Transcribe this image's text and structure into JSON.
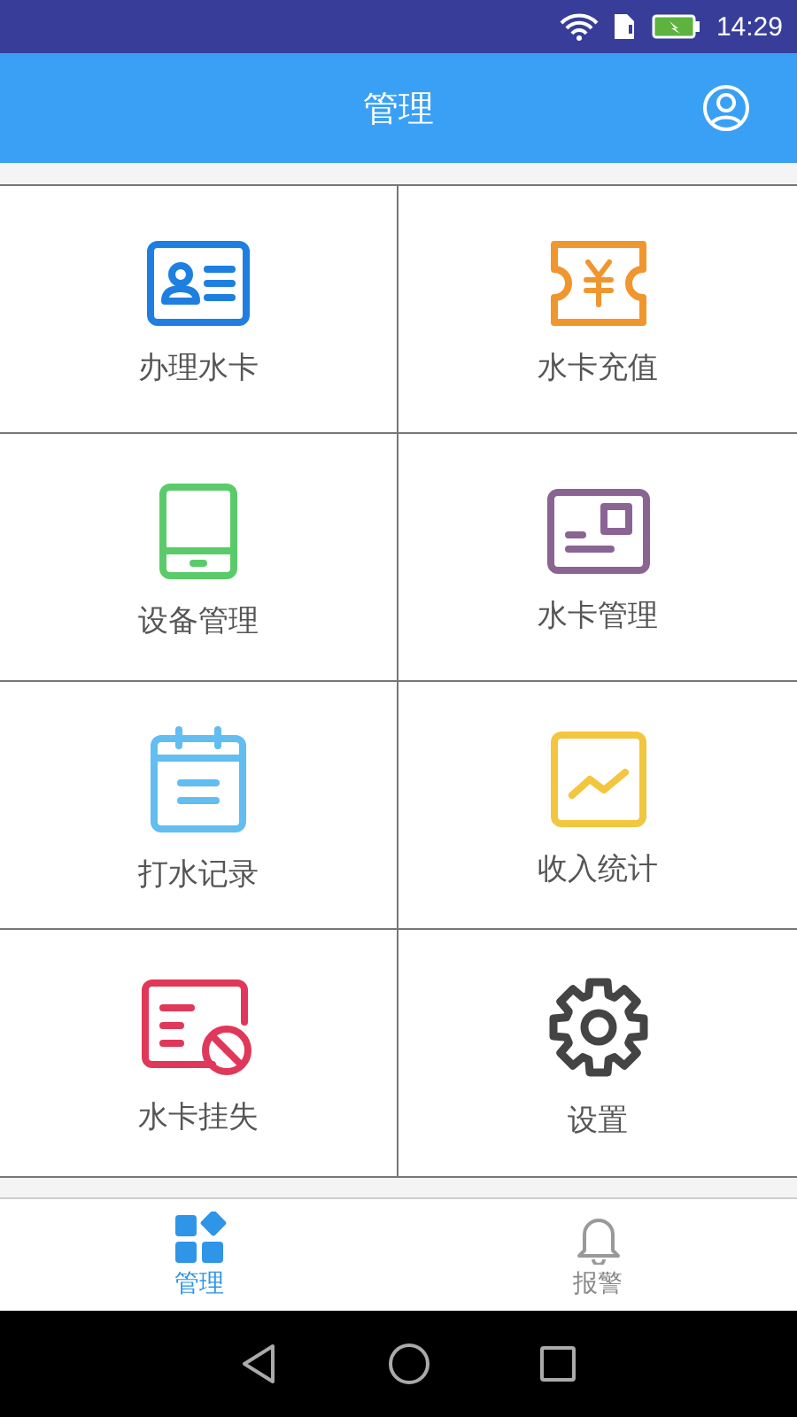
{
  "status_bar": {
    "time": "14:29",
    "battery_charging": true
  },
  "app_bar": {
    "title": "管理"
  },
  "tiles": [
    {
      "label": "办理水卡",
      "kind": "id-card",
      "color": "#1f7fe0"
    },
    {
      "label": "水卡充值",
      "kind": "ticket",
      "color": "#f0962e"
    },
    {
      "label": "设备管理",
      "kind": "tablet",
      "color": "#5acb6a"
    },
    {
      "label": "水卡管理",
      "kind": "card",
      "color": "#8a6593"
    },
    {
      "label": "打水记录",
      "kind": "calendar",
      "color": "#62bdf0"
    },
    {
      "label": "收入统计",
      "kind": "chart",
      "color": "#f2c63e"
    },
    {
      "label": "水卡挂失",
      "kind": "blocked",
      "color": "#e0385a"
    },
    {
      "label": "设置",
      "kind": "gear",
      "color": "#444444"
    }
  ],
  "bottom_tabs": [
    {
      "label": "管理",
      "kind": "grid",
      "selected": true
    },
    {
      "label": "报警",
      "kind": "bell",
      "selected": false
    }
  ]
}
